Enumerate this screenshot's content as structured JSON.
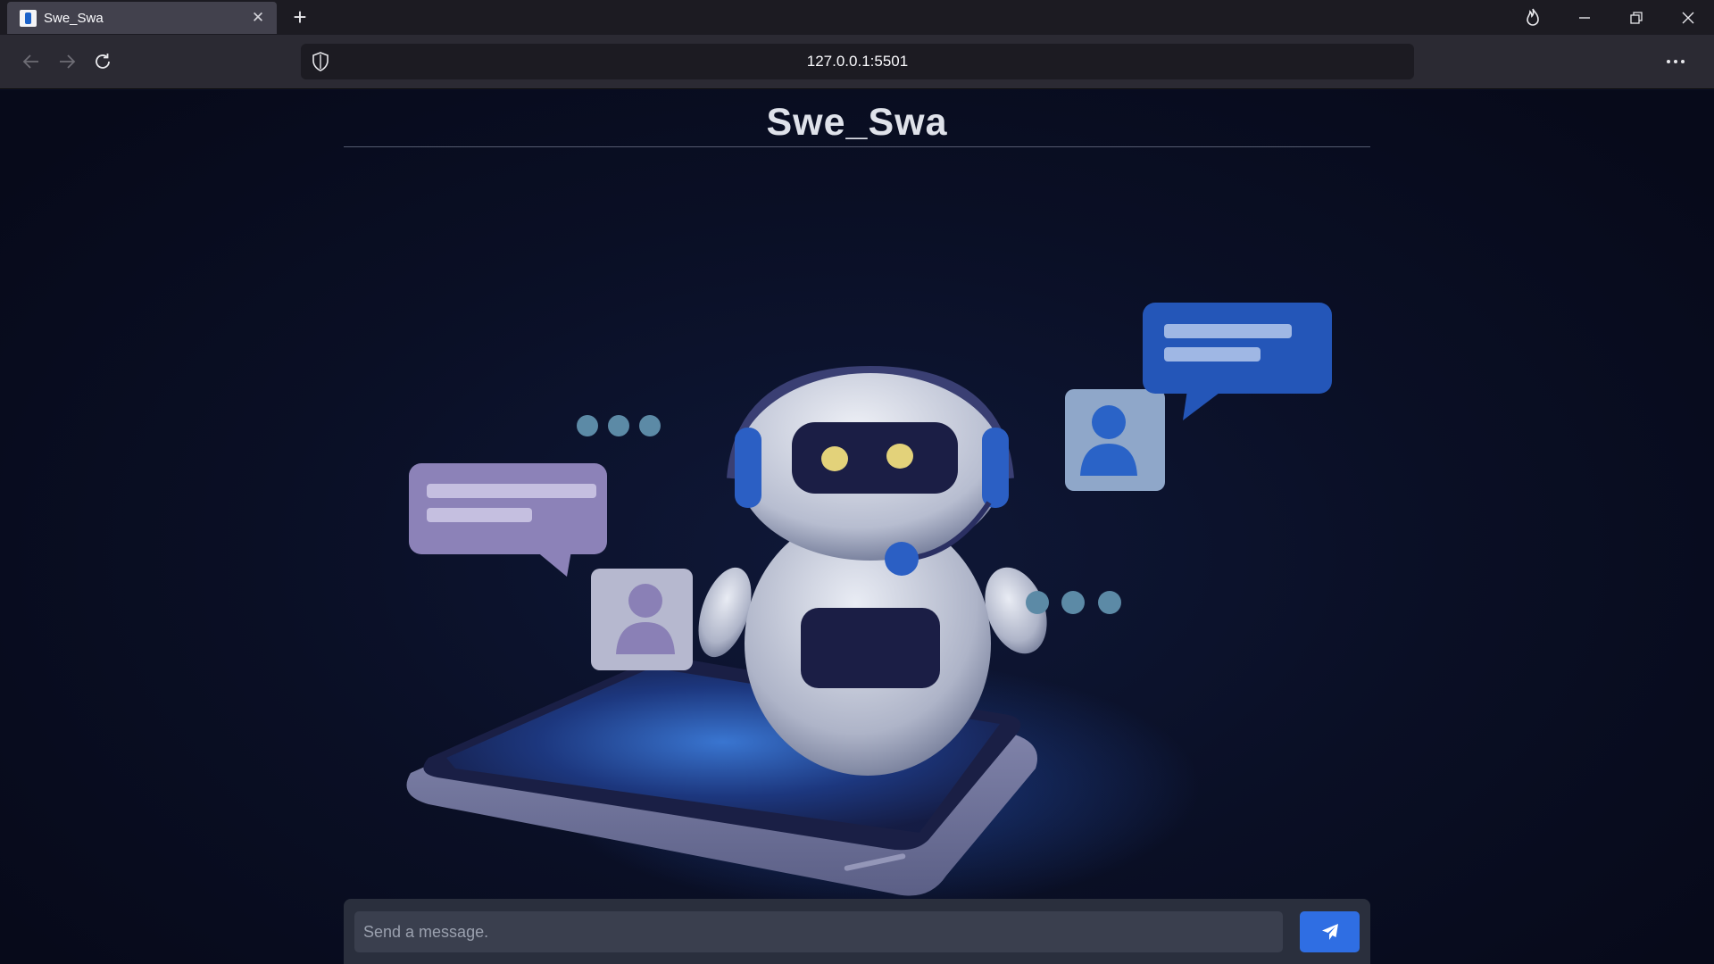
{
  "browser": {
    "tab_title": "Swe_Swa",
    "url": "127.0.0.1:5501"
  },
  "page": {
    "title": "Swe_Swa",
    "input_placeholder": "Send a message."
  },
  "colors": {
    "accent": "#2f6ee3",
    "background": "#0b0f24"
  },
  "icons": {
    "tab_close": "close-icon",
    "new_tab": "plus-icon",
    "send": "paper-plane-icon"
  }
}
